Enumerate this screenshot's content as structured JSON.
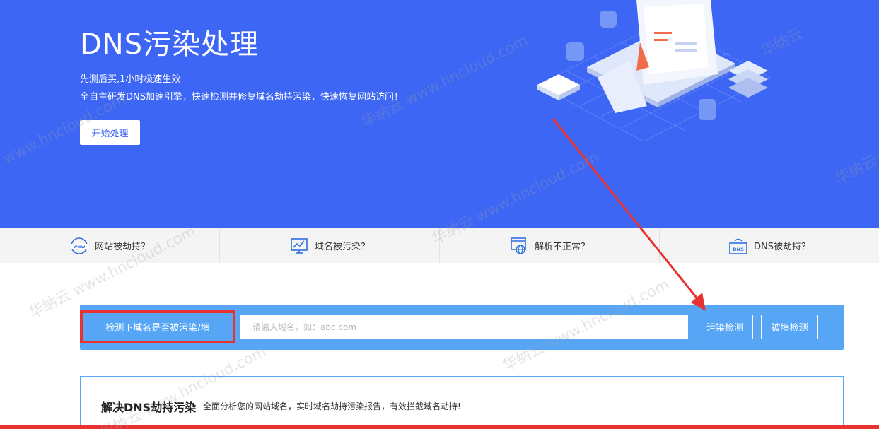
{
  "hero": {
    "title": "DNS污染处理",
    "subtitle_1": "先测后买,1小时极速生效",
    "subtitle_2": "全自主研发DNS加速引擎，快速检测并修复域名劫持污染，快速恢复网站访问！",
    "start_button": "开始处理",
    "background_color": "#3d66f5"
  },
  "features": [
    {
      "label": "网站被劫持？",
      "icon": "www-icon"
    },
    {
      "label": "域名被污染？",
      "icon": "chart-icon"
    },
    {
      "label": "解析不正常？",
      "icon": "globe-browser-icon"
    },
    {
      "label": "DNS被劫持？",
      "icon": "dns-server-icon"
    }
  ],
  "search": {
    "label": "检测下域名是否被污染/墙",
    "placeholder": "请输入域名，如：abc.com",
    "pollution_button": "污染检测",
    "wall_button": "被墙检测",
    "bar_color": "#56a6f5",
    "highlight_color": "#e8322f"
  },
  "solution": {
    "title": "解决DNS劫持污染",
    "description": "全面分析您的网站域名，实时域名劫持污染报告，有效拦截域名劫持!"
  },
  "watermark": {
    "text_1": "华纳云 www.hncloud.com",
    "text_2": "www.hncloud.com",
    "text_3": "华纳云"
  }
}
